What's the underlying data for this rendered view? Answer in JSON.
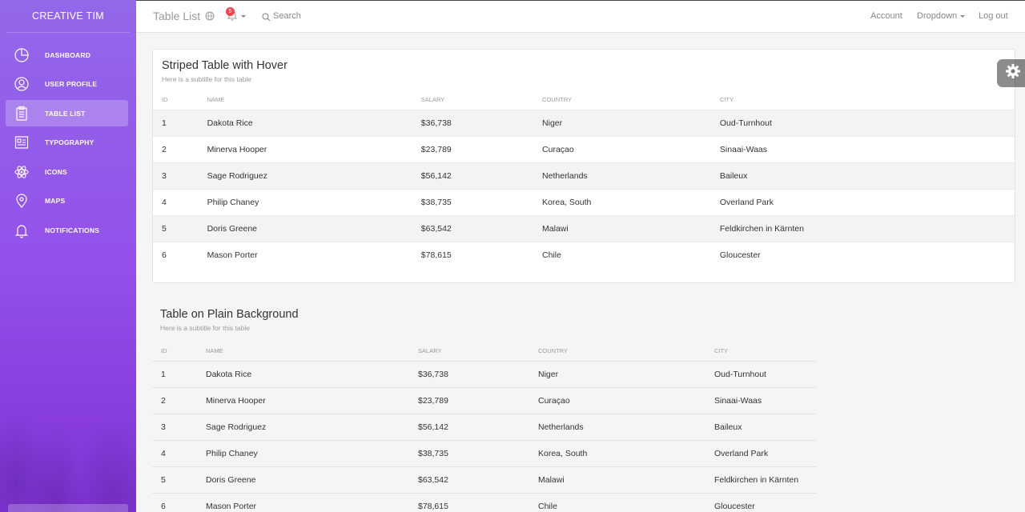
{
  "sidebar": {
    "brand": "CREATIVE TIM",
    "items": [
      {
        "label": "DASHBOARD",
        "icon": "pie-chart-icon",
        "active": false
      },
      {
        "label": "USER PROFILE",
        "icon": "user-icon",
        "active": false
      },
      {
        "label": "TABLE LIST",
        "icon": "clipboard-icon",
        "active": true
      },
      {
        "label": "TYPOGRAPHY",
        "icon": "news-paper-icon",
        "active": false
      },
      {
        "label": "ICONS",
        "icon": "atom-icon",
        "active": false
      },
      {
        "label": "MAPS",
        "icon": "map-pin-icon",
        "active": false
      },
      {
        "label": "NOTIFICATIONS",
        "icon": "bell-icon",
        "active": false
      }
    ]
  },
  "topbar": {
    "title": "Table List",
    "notification_count": "5",
    "search_label": "Search",
    "account": "Account",
    "dropdown": "Dropdown",
    "logout": "Log out"
  },
  "striped_table": {
    "title": "Striped Table with Hover",
    "subtitle": "Here is a subtitle for this table",
    "headers": [
      "ID",
      "NAME",
      "SALARY",
      "COUNTRY",
      "CITY"
    ],
    "rows": [
      [
        "1",
        "Dakota Rice",
        "$36,738",
        "Niger",
        "Oud-Turnhout"
      ],
      [
        "2",
        "Minerva Hooper",
        "$23,789",
        "Curaçao",
        "Sinaai-Waas"
      ],
      [
        "3",
        "Sage Rodriguez",
        "$56,142",
        "Netherlands",
        "Baileux"
      ],
      [
        "4",
        "Philip Chaney",
        "$38,735",
        "Korea, South",
        "Overland Park"
      ],
      [
        "5",
        "Doris Greene",
        "$63,542",
        "Malawi",
        "Feldkirchen in Kärnten"
      ],
      [
        "6",
        "Mason Porter",
        "$78,615",
        "Chile",
        "Gloucester"
      ]
    ]
  },
  "plain_table": {
    "title": "Table on Plain Background",
    "subtitle": "Here is a subtitle for this table",
    "headers": [
      "ID",
      "NAME",
      "SALARY",
      "COUNTRY",
      "CITY"
    ],
    "rows": [
      [
        "1",
        "Dakota Rice",
        "$36,738",
        "Niger",
        "Oud-Turnhout"
      ],
      [
        "2",
        "Minerva Hooper",
        "$23,789",
        "Curaçao",
        "Sinaai-Waas"
      ],
      [
        "3",
        "Sage Rodriguez",
        "$56,142",
        "Netherlands",
        "Baileux"
      ],
      [
        "4",
        "Philip Chaney",
        "$38,735",
        "Korea, South",
        "Overland Park"
      ],
      [
        "5",
        "Doris Greene",
        "$63,542",
        "Malawi",
        "Feldkirchen in Kärnten"
      ],
      [
        "6",
        "Mason Porter",
        "$78,615",
        "Chile",
        "Gloucester"
      ]
    ]
  },
  "colors": {
    "sidebar_top": "#9368e9",
    "sidebar_bottom": "#943bea",
    "badge": "#fb404b"
  }
}
